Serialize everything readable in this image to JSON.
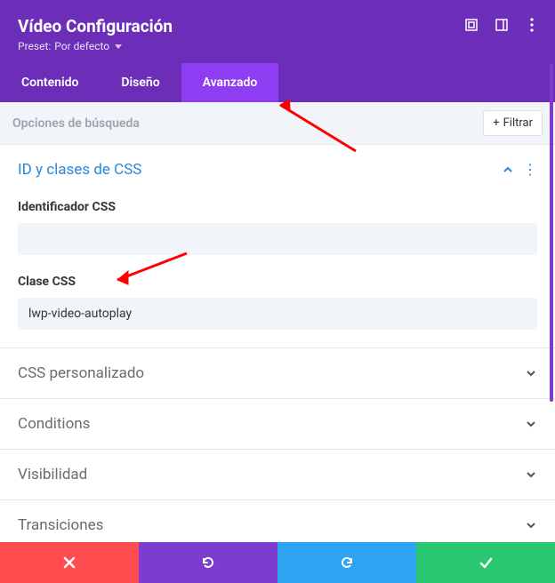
{
  "header": {
    "title": "Vídeo Configuración",
    "preset_prefix": "Preset:",
    "preset_value": "Por defecto"
  },
  "tabs": {
    "items": [
      {
        "label": "Contenido",
        "active": false
      },
      {
        "label": "Diseño",
        "active": false
      },
      {
        "label": "Avanzado",
        "active": true
      }
    ]
  },
  "search": {
    "placeholder": "Opciones de búsqueda",
    "filter_label": "Filtrar"
  },
  "sections": {
    "css_id": {
      "title": "ID y clases de CSS",
      "open": true,
      "fields": {
        "id_label": "Identificador CSS",
        "id_value": "",
        "class_label": "Clase CSS",
        "class_value": "lwp-video-autoplay"
      }
    },
    "custom_css": {
      "title": "CSS personalizado"
    },
    "conditions": {
      "title": "Conditions"
    },
    "visibility": {
      "title": "Visibilidad"
    },
    "transitions": {
      "title": "Transiciones"
    }
  },
  "footer": {
    "cancel": "cancel",
    "undo": "undo",
    "redo": "redo",
    "save": "save"
  }
}
